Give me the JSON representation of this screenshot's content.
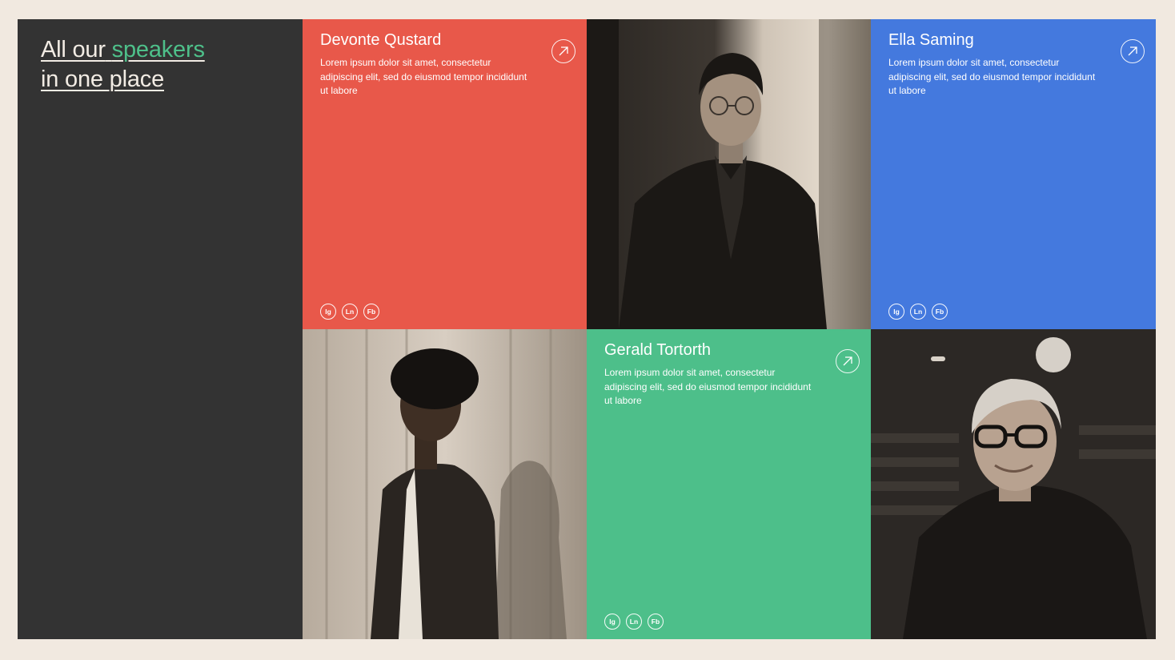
{
  "intro": {
    "line1_prefix": "All our",
    "line1_accent": "speakers",
    "line2": "in one place",
    "accent_color": "#4ec08a"
  },
  "speakers": [
    {
      "name": "Devonte Qustard",
      "description": "Lorem ipsum dolor sit amet, consectetur adipiscing elit, sed do eiusmod tempor incididunt ut labore",
      "color": "#e8584a",
      "socials": [
        "Ig",
        "Ln",
        "Fb"
      ]
    },
    {
      "name": "Ella Saming",
      "description": "Lorem ipsum dolor sit amet, consectetur adipiscing elit, sed do eiusmod tempor incididunt ut labore",
      "color": "#4479de",
      "socials": [
        "Ig",
        "Ln",
        "Fb"
      ]
    },
    {
      "name": "Gerald Tortorth",
      "description": "Lorem ipsum dolor sit amet, consectetur adipiscing elit, sed do eiusmod tempor incididunt ut labore",
      "color": "#4dbf8a",
      "socials": [
        "Ig",
        "Ln",
        "Fb"
      ]
    }
  ],
  "icons": {
    "arrow": "arrow-up-right-icon"
  }
}
